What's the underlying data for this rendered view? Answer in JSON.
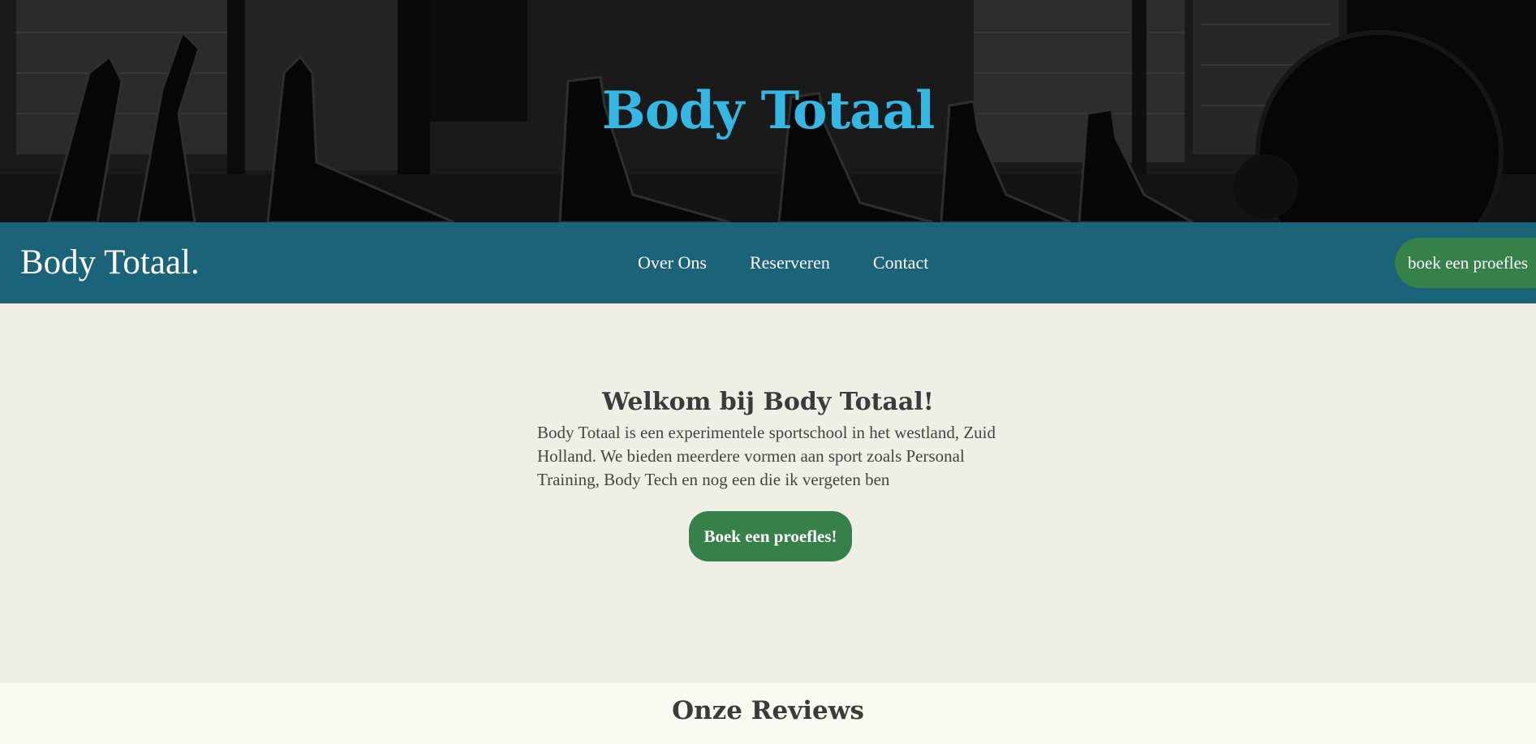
{
  "hero": {
    "title": "Body Totaal",
    "background_image": "gym-treadmills-photo"
  },
  "navbar": {
    "brand": "Body Totaal.",
    "links": [
      "Over Ons",
      "Reserveren",
      "Contact"
    ],
    "cta_label": "boek een proefles"
  },
  "welcome": {
    "title": "Welkom bij Body Totaal!",
    "text": "Body Totaal is een experimentele sportschool in het westland, Zuid Holland. We bieden meerdere vormen aan sport zoals Personal Training, Body Tech en nog een die ik vergeten ben",
    "button_label": "Boek een proefles!"
  },
  "reviews": {
    "title": "Onze Reviews"
  },
  "colors": {
    "hero_title": "#33b8e6",
    "navbar_bg": "#1a6379",
    "button_green": "#36804a",
    "welcome_bg": "#f0efe6",
    "reviews_bg": "#fafaf2",
    "heading_text": "#3b3b3b"
  }
}
